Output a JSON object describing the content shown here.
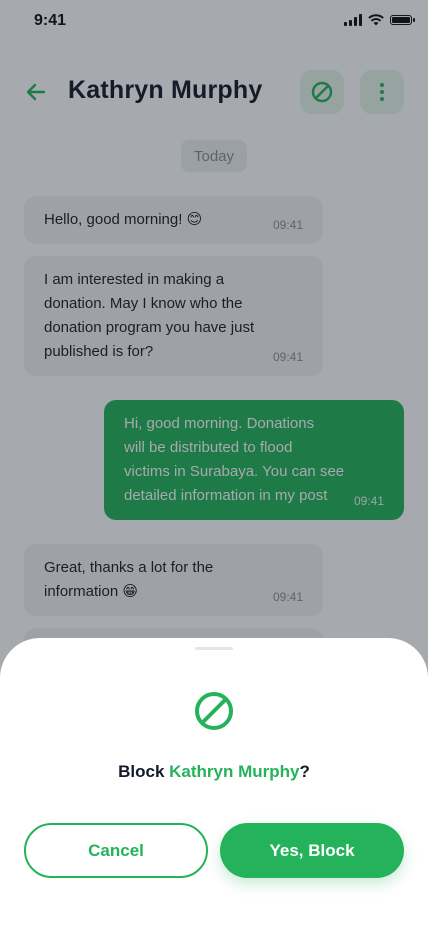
{
  "status_bar": {
    "time": "9:41"
  },
  "header": {
    "contact_name": "Kathryn Murphy"
  },
  "chat": {
    "day_label": "Today",
    "messages": [
      {
        "direction": "incoming",
        "lines": [
          "Hello, good morning! 😊"
        ],
        "time": "09:41"
      },
      {
        "direction": "incoming",
        "lines": [
          "I am interested in making a",
          "donation. May I know who the",
          "donation program you have just",
          "published is for?"
        ],
        "time": "09:41"
      },
      {
        "direction": "outgoing",
        "lines": [
          "Hi, good morning. Donations",
          "will be distributed to flood",
          "victims in Surabaya. You can see",
          "detailed information in my post"
        ],
        "time": "09:41"
      },
      {
        "direction": "incoming",
        "lines": [
          "Great, thanks a lot for the",
          "information 😁"
        ],
        "time": "09:41"
      }
    ]
  },
  "block_sheet": {
    "prefix": "Block ",
    "name": "Kathryn Murphy",
    "suffix": "?",
    "cancel_label": "Cancel",
    "confirm_label": "Yes, Block"
  },
  "colors": {
    "accent": "#24b35a",
    "overlay": "#141c28"
  },
  "icons": {
    "back": "arrow-left-icon",
    "block": "block-icon",
    "more": "more-vertical-icon"
  }
}
